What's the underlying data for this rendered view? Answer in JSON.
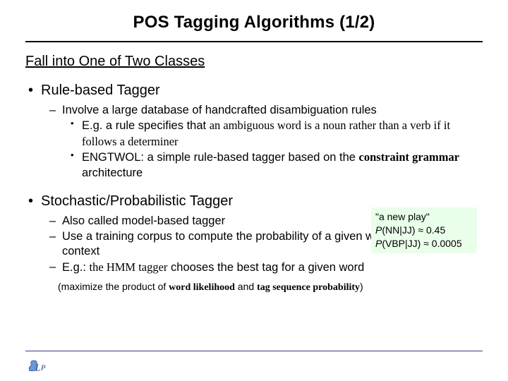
{
  "title": "POS Tagging Algorithms (1/2)",
  "subhead": "Fall into One of Two Classes",
  "items": [
    {
      "label": "Rule-based Tagger",
      "sub": [
        {
          "text": "Involve a large database of handcrafted disambiguation rules",
          "sub": [
            {
              "pre": "E.g. a rule specifies that ",
              "em": "an ambiguous word is a noun rather than a verb if it follows a determiner"
            },
            {
              "pre": "ENGTWOL: a simple rule-based tagger based on the ",
              "em2": "constraint grammar",
              "post": " architecture"
            }
          ]
        }
      ]
    },
    {
      "label": "Stochastic/Probabilistic Tagger",
      "sub": [
        {
          "text": "Also called model-based tagger"
        },
        {
          "text": " Use a training corpus to compute the probability of a given word having a given context"
        },
        {
          "pre": "E.g.: ",
          "em2": "the HMM tagger",
          "post": " chooses the best tag for a given word"
        }
      ]
    }
  ],
  "note": {
    "line1": "\"a new play\"",
    "p1_lhs": "P",
    "p1_arg": "(NN|JJ) ≈ 0.45",
    "p2_lhs": "P",
    "p2_arg": "(VBP|JJ) ≈ 0.0005"
  },
  "footnote": {
    "pre": "(maximize the product of ",
    "em1": "word likelihood",
    "mid": " and ",
    "em2": "tag sequence probability",
    "post": ")"
  }
}
